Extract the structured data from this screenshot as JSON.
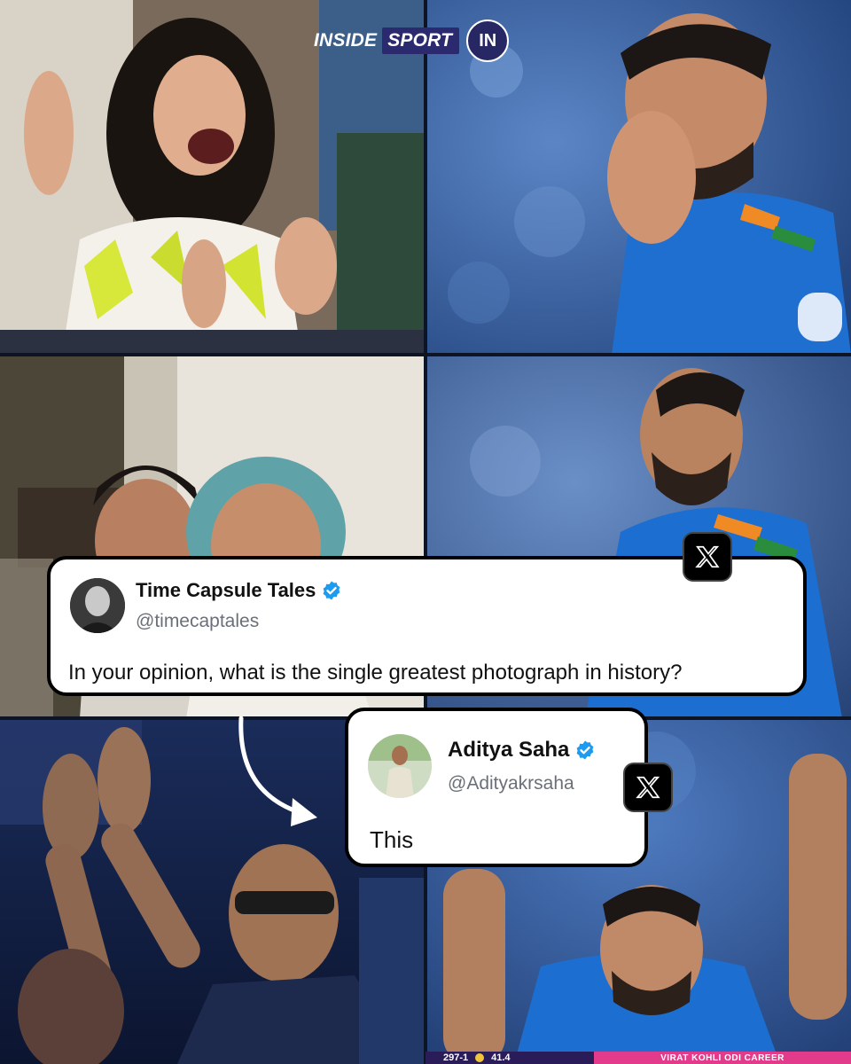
{
  "brand": {
    "text_inside": "INSIDE",
    "text_sport": "SPORT",
    "logo_letters": "IN"
  },
  "tweet_main": {
    "name": "Time Capsule Tales",
    "handle": "@timecaptales",
    "text": "In your opinion, what is the single greatest photograph in history?",
    "platform_icon": "x-logo-icon"
  },
  "tweet_reply": {
    "name": "Aditya Saha",
    "handle": "@Adityakrsaha",
    "text": "This",
    "platform_icon": "x-logo-icon"
  },
  "scoreboard": {
    "score": "297-1",
    "overs": "41.4",
    "label": "VIRAT KOHLI ODI CAREER"
  },
  "colors": {
    "brand_navy": "#262763",
    "verified_blue": "#1d9bf0",
    "india_blue": "#1565c0",
    "score_pink": "#e23b8c"
  }
}
